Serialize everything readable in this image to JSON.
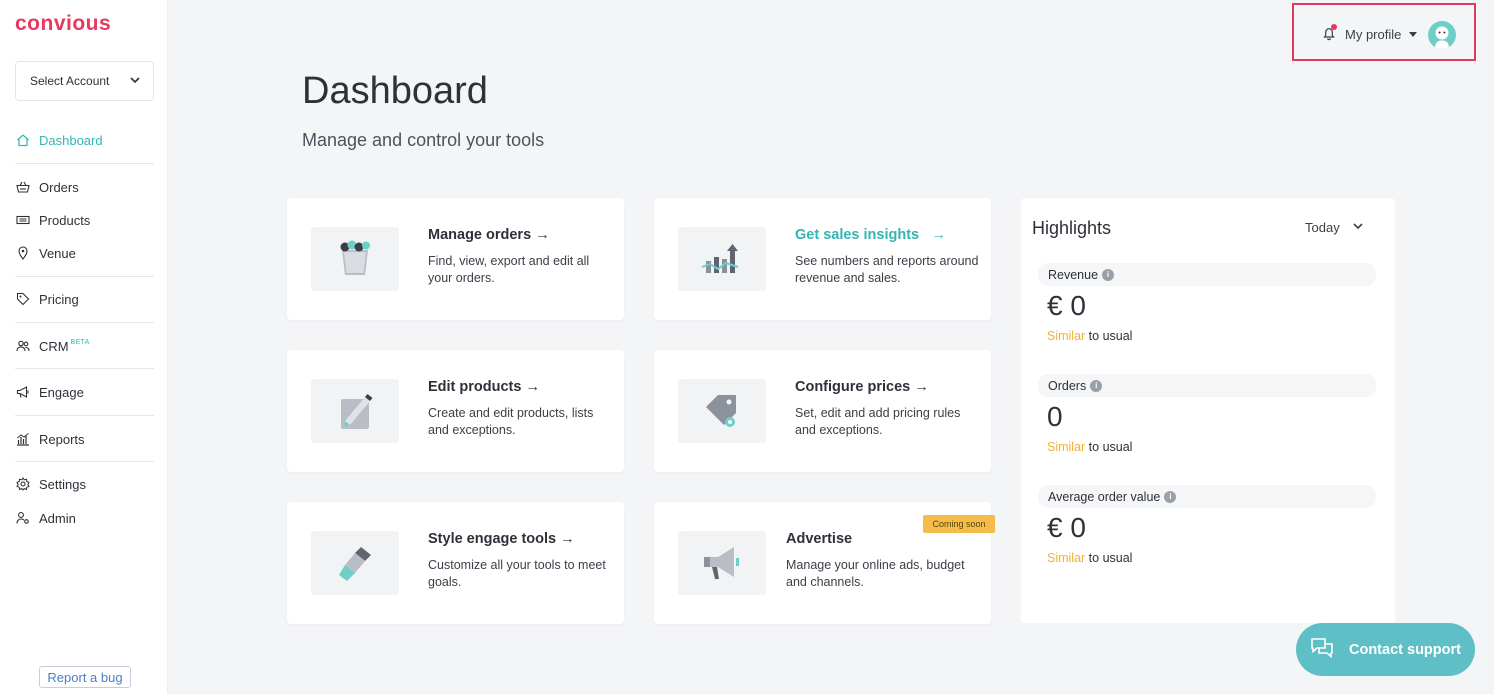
{
  "brand": {
    "logo": "convious",
    "accent": "#e8385e",
    "teal": "#33b5b3"
  },
  "sidebar": {
    "account_select": "Select Account",
    "items": [
      {
        "label": "Dashboard",
        "icon": "home-icon",
        "active": true
      },
      {
        "label": "Orders",
        "icon": "basket-icon"
      },
      {
        "label": "Products",
        "icon": "ticket-icon"
      },
      {
        "label": "Venue",
        "icon": "location-pin-icon"
      },
      {
        "label": "Pricing",
        "icon": "tag-icon"
      },
      {
        "label": "CRM",
        "icon": "users-icon",
        "badge": "BETA"
      },
      {
        "label": "Engage",
        "icon": "megaphone-icon"
      },
      {
        "label": "Reports",
        "icon": "chart-icon"
      },
      {
        "label": "Settings",
        "icon": "gear-icon"
      },
      {
        "label": "Admin",
        "icon": "user-gear-icon"
      }
    ],
    "report_bug": "Report a bug"
  },
  "header": {
    "profile_label": "My profile"
  },
  "main": {
    "title": "Dashboard",
    "subtitle": "Manage and control your tools",
    "cards": [
      {
        "title": "Manage orders",
        "arrow": "→",
        "desc": "Find, view, export and edit all your orders."
      },
      {
        "title": "Get sales insights",
        "arrow": "→",
        "desc": "See numbers and reports around revenue and sales."
      },
      {
        "title": "Edit products",
        "arrow": "→",
        "desc": "Create and edit products, lists and exceptions."
      },
      {
        "title": "Configure prices",
        "arrow": "→",
        "desc": "Set, edit and add pricing rules and exceptions."
      },
      {
        "title": "Style engage tools",
        "arrow": "→",
        "desc": "Customize all your tools to meet goals."
      },
      {
        "title": "Advertise",
        "arrow": "",
        "desc": "Manage your online ads, budget and channels.",
        "badge": "Coming soon"
      }
    ]
  },
  "highlights": {
    "title": "Highlights",
    "period": "Today",
    "metrics": [
      {
        "label": "Revenue",
        "value": "€ 0",
        "similar": "Similar",
        "compare": " to usual"
      },
      {
        "label": "Orders",
        "value": "0",
        "similar": "Similar",
        "compare": " to usual"
      },
      {
        "label": "Average order value",
        "value": "€ 0",
        "similar": "Similar",
        "compare": " to usual"
      }
    ]
  },
  "support": {
    "label": "Contact support"
  }
}
